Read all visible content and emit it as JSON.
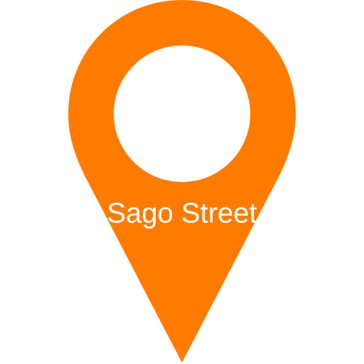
{
  "marker": {
    "label": "Sago Street",
    "icon": "map-pin-icon",
    "fill_color": "#ff7b00",
    "hole_color": "#ffffff",
    "label_color": "#ffffff"
  }
}
